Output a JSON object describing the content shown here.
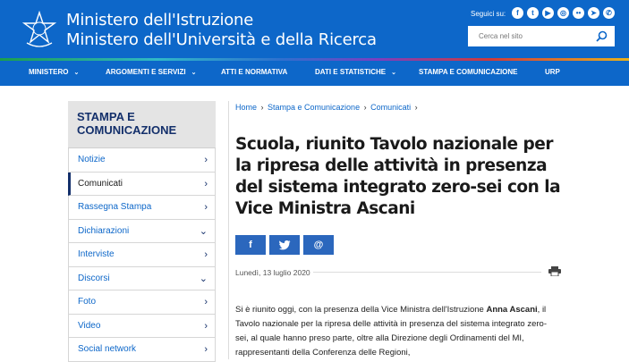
{
  "header": {
    "title_line1": "Ministero dell'Istruzione",
    "title_line2": "Ministero dell'Università e della Ricerca",
    "social_label": "Seguici su:",
    "social_icons": [
      "facebook-icon",
      "twitter-icon",
      "youtube-icon",
      "instagram-icon",
      "flickr-icon",
      "telegram-icon",
      "rss-icon",
      "whatsapp-icon"
    ],
    "search_placeholder": "Cerca nel sito"
  },
  "nav": [
    {
      "label": "MINISTERO",
      "has_dropdown": true
    },
    {
      "label": "ARGOMENTI E SERVIZI",
      "has_dropdown": true
    },
    {
      "label": "ATTI E NORMATIVA",
      "has_dropdown": false
    },
    {
      "label": "DATI E STATISTICHE",
      "has_dropdown": true
    },
    {
      "label": "STAMPA E COMUNICAZIONE",
      "has_dropdown": false
    },
    {
      "label": "URP",
      "has_dropdown": false
    }
  ],
  "sidebar": {
    "heading": "STAMPA E COMUNICAZIONE",
    "items": [
      {
        "label": "Notizie",
        "chevron": "›"
      },
      {
        "label": "Comunicati",
        "chevron": "›"
      },
      {
        "label": "Rassegna Stampa",
        "chevron": "›"
      },
      {
        "label": "Dichiarazioni",
        "chevron": "⌄"
      },
      {
        "label": "Interviste",
        "chevron": "›"
      },
      {
        "label": "Discorsi",
        "chevron": "⌄"
      },
      {
        "label": "Foto",
        "chevron": "›"
      },
      {
        "label": "Video",
        "chevron": "›"
      },
      {
        "label": "Social network",
        "chevron": "›"
      }
    ],
    "active_index": 1
  },
  "breadcrumb": [
    "Home",
    "Stampa e Comunicazione",
    "Comunicati"
  ],
  "article": {
    "title": "Scuola, riunito Tavolo nazionale per la ripresa delle attività in presenza del sistema integrato zero-sei con la Vice Ministra Ascani",
    "share": [
      {
        "icon": "facebook-icon",
        "glyph": "f"
      },
      {
        "icon": "twitter-icon",
        "glyph": "🐦"
      },
      {
        "icon": "email-icon",
        "glyph": "@"
      }
    ],
    "date": "Lunedì, 13 luglio 2020",
    "body_part1": "Si è riunito oggi, con la presenza della Vice Ministra dell'Istruzione ",
    "body_bold": "Anna Ascani",
    "body_part2": ", il Tavolo nazionale per la ripresa delle attività in presenza del sistema integrato zero-sei, al quale hanno preso parte, oltre alla Direzione degli Ordinamenti del MI, rappresentanti della Conferenza delle Regioni,"
  },
  "colors": {
    "header_bg": "#0d67c9",
    "nav_text": "#ffffff",
    "sidebar_heading": "#14306b",
    "link": "#0d67c9",
    "share_bg": "#2b67bd"
  }
}
